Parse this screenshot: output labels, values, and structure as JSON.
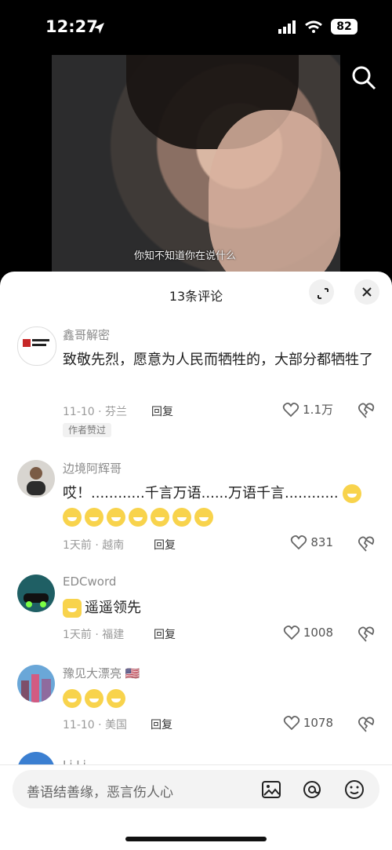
{
  "status_bar": {
    "time": "12:27",
    "battery": "82"
  },
  "video": {
    "subtitle": "你知不知道你在说什么"
  },
  "comments_panel": {
    "title": "13条评论",
    "input_placeholder": "善语结善缘，恶言伤人心",
    "author_liked_badge": "作者赞过",
    "reply_label": "回复",
    "items": [
      {
        "name": "鑫哥解密",
        "text": "致敬先烈，愿意为人民而牺牲的，大部分都牺牲了",
        "meta": "11-10 · 芬兰",
        "likes": "1.1万"
      },
      {
        "name": "边境阿辉哥",
        "text": "哎！............千言万语......万语千言............",
        "meta": "1天前 · 越南",
        "likes": "831"
      },
      {
        "name": "EDCword",
        "text": "遥遥领先",
        "meta": "1天前 · 福建",
        "likes": "1008"
      },
      {
        "name": "豫见大漂亮 🇺🇸",
        "text": "",
        "meta": "11-10 · 美国",
        "likes": "1078"
      },
      {
        "name": "Li Li",
        "text": "",
        "meta": "",
        "likes": ""
      }
    ]
  },
  "colors": {
    "sheet_bg": "#ffffff",
    "text_dark": "#1f1f1f",
    "muted": "#9a9a9a"
  }
}
